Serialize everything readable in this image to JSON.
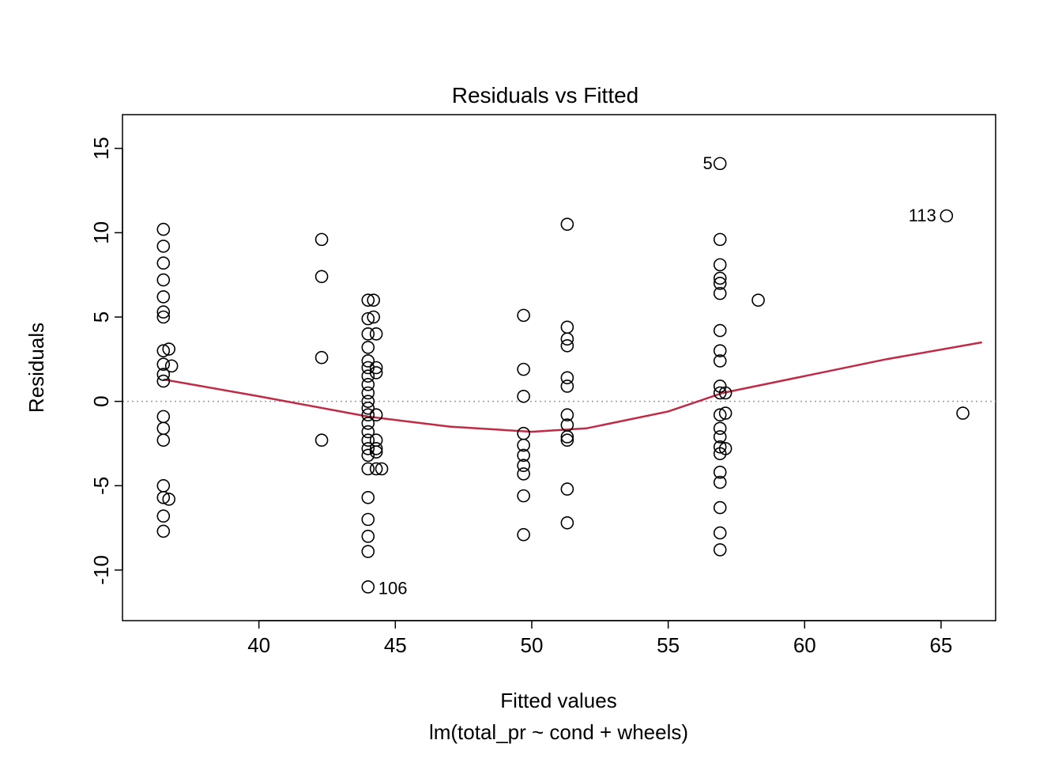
{
  "chart_data": {
    "type": "scatter",
    "title": "Residuals vs Fitted",
    "xlabel": "Fitted values",
    "ylabel": "Residuals",
    "subtitle": "lm(total_pr ~ cond + wheels)",
    "xlim": [
      35,
      67
    ],
    "ylim": [
      -13,
      17
    ],
    "x_ticks": [
      40,
      45,
      50,
      55,
      60,
      65
    ],
    "y_ticks": [
      -10,
      -5,
      0,
      5,
      10,
      15
    ],
    "hline": 0,
    "lowess": {
      "x": [
        36.5,
        40,
        44,
        47,
        50,
        52,
        55,
        57,
        60,
        63,
        66.5
      ],
      "y": [
        1.3,
        0.3,
        -0.9,
        -1.5,
        -1.8,
        -1.6,
        -0.6,
        0.5,
        1.5,
        2.5,
        3.5
      ]
    },
    "lowess_color": "#c12a46",
    "annotations": [
      {
        "label": "5",
        "x": 57.0,
        "y": 14.1,
        "side": "left"
      },
      {
        "label": "113",
        "x": 65.2,
        "y": 11.0,
        "side": "left"
      },
      {
        "label": "106",
        "x": 44.0,
        "y": -11.0,
        "side": "right"
      }
    ],
    "points": [
      {
        "x": 36.5,
        "y": 10.2
      },
      {
        "x": 36.5,
        "y": 9.2
      },
      {
        "x": 36.5,
        "y": 8.2
      },
      {
        "x": 36.5,
        "y": 7.2
      },
      {
        "x": 36.5,
        "y": 6.2
      },
      {
        "x": 36.5,
        "y": 5.3
      },
      {
        "x": 36.5,
        "y": 5.0
      },
      {
        "x": 36.7,
        "y": 3.1
      },
      {
        "x": 36.5,
        "y": 3.0
      },
      {
        "x": 36.5,
        "y": 2.2
      },
      {
        "x": 36.8,
        "y": 2.1
      },
      {
        "x": 36.5,
        "y": 1.6
      },
      {
        "x": 36.5,
        "y": 1.2
      },
      {
        "x": 36.5,
        "y": -0.9
      },
      {
        "x": 36.5,
        "y": -1.6
      },
      {
        "x": 36.5,
        "y": -2.3
      },
      {
        "x": 36.5,
        "y": -5.0
      },
      {
        "x": 36.5,
        "y": -5.7
      },
      {
        "x": 36.7,
        "y": -5.8
      },
      {
        "x": 36.5,
        "y": -6.8
      },
      {
        "x": 36.5,
        "y": -7.7
      },
      {
        "x": 42.3,
        "y": 9.6
      },
      {
        "x": 42.3,
        "y": 7.4
      },
      {
        "x": 42.3,
        "y": 2.6
      },
      {
        "x": 42.3,
        "y": -2.3
      },
      {
        "x": 44.0,
        "y": 6.0
      },
      {
        "x": 44.2,
        "y": 6.0
      },
      {
        "x": 44.0,
        "y": 4.9
      },
      {
        "x": 44.2,
        "y": 5.0
      },
      {
        "x": 44.0,
        "y": 4.0
      },
      {
        "x": 44.3,
        "y": 4.0
      },
      {
        "x": 44.0,
        "y": 3.2
      },
      {
        "x": 44.0,
        "y": 2.4
      },
      {
        "x": 44.0,
        "y": 2.0
      },
      {
        "x": 44.3,
        "y": 2.0
      },
      {
        "x": 44.0,
        "y": 1.5
      },
      {
        "x": 44.3,
        "y": 1.7
      },
      {
        "x": 44.0,
        "y": 1.0
      },
      {
        "x": 44.0,
        "y": 0.5
      },
      {
        "x": 44.0,
        "y": 0.0
      },
      {
        "x": 44.0,
        "y": -0.4
      },
      {
        "x": 44.0,
        "y": -0.8
      },
      {
        "x": 44.3,
        "y": -0.8
      },
      {
        "x": 44.0,
        "y": -1.3
      },
      {
        "x": 44.0,
        "y": -1.8
      },
      {
        "x": 44.0,
        "y": -2.3
      },
      {
        "x": 44.3,
        "y": -2.3
      },
      {
        "x": 44.0,
        "y": -2.8
      },
      {
        "x": 44.3,
        "y": -2.8
      },
      {
        "x": 44.0,
        "y": -3.2
      },
      {
        "x": 44.3,
        "y": -3.0
      },
      {
        "x": 44.0,
        "y": -4.0
      },
      {
        "x": 44.3,
        "y": -4.0
      },
      {
        "x": 44.5,
        "y": -4.0
      },
      {
        "x": 44.0,
        "y": -5.7
      },
      {
        "x": 44.0,
        "y": -7.0
      },
      {
        "x": 44.0,
        "y": -8.0
      },
      {
        "x": 44.0,
        "y": -8.9
      },
      {
        "x": 44.0,
        "y": -11.0
      },
      {
        "x": 49.7,
        "y": 5.1
      },
      {
        "x": 49.7,
        "y": 1.9
      },
      {
        "x": 49.7,
        "y": 0.3
      },
      {
        "x": 49.7,
        "y": -1.9
      },
      {
        "x": 49.7,
        "y": -2.6
      },
      {
        "x": 49.7,
        "y": -3.2
      },
      {
        "x": 49.7,
        "y": -3.8
      },
      {
        "x": 49.7,
        "y": -4.3
      },
      {
        "x": 49.7,
        "y": -5.6
      },
      {
        "x": 49.7,
        "y": -7.9
      },
      {
        "x": 51.3,
        "y": 10.5
      },
      {
        "x": 51.3,
        "y": 4.4
      },
      {
        "x": 51.3,
        "y": 3.7
      },
      {
        "x": 51.3,
        "y": 3.3
      },
      {
        "x": 51.3,
        "y": 1.4
      },
      {
        "x": 51.3,
        "y": 0.9
      },
      {
        "x": 51.3,
        "y": -0.8
      },
      {
        "x": 51.3,
        "y": -1.4
      },
      {
        "x": 51.3,
        "y": -2.1
      },
      {
        "x": 51.3,
        "y": -2.3
      },
      {
        "x": 51.3,
        "y": -5.2
      },
      {
        "x": 51.3,
        "y": -7.2
      },
      {
        "x": 56.9,
        "y": 14.1
      },
      {
        "x": 56.9,
        "y": 9.6
      },
      {
        "x": 56.9,
        "y": 8.1
      },
      {
        "x": 56.9,
        "y": 7.3
      },
      {
        "x": 56.9,
        "y": 7.0
      },
      {
        "x": 56.9,
        "y": 6.4
      },
      {
        "x": 56.9,
        "y": 4.2
      },
      {
        "x": 56.9,
        "y": 3.0
      },
      {
        "x": 56.9,
        "y": 2.4
      },
      {
        "x": 56.9,
        "y": 0.9
      },
      {
        "x": 56.9,
        "y": 0.5
      },
      {
        "x": 57.1,
        "y": 0.5
      },
      {
        "x": 56.9,
        "y": -0.8
      },
      {
        "x": 57.1,
        "y": -0.7
      },
      {
        "x": 56.9,
        "y": -1.6
      },
      {
        "x": 56.9,
        "y": -2.1
      },
      {
        "x": 56.9,
        "y": -2.7
      },
      {
        "x": 57.1,
        "y": -2.8
      },
      {
        "x": 56.9,
        "y": -3.1
      },
      {
        "x": 56.9,
        "y": -4.2
      },
      {
        "x": 56.9,
        "y": -4.8
      },
      {
        "x": 56.9,
        "y": -6.3
      },
      {
        "x": 56.9,
        "y": -7.8
      },
      {
        "x": 56.9,
        "y": -8.8
      },
      {
        "x": 58.3,
        "y": 6.0
      },
      {
        "x": 65.2,
        "y": 11.0
      },
      {
        "x": 65.8,
        "y": -0.7
      }
    ]
  }
}
